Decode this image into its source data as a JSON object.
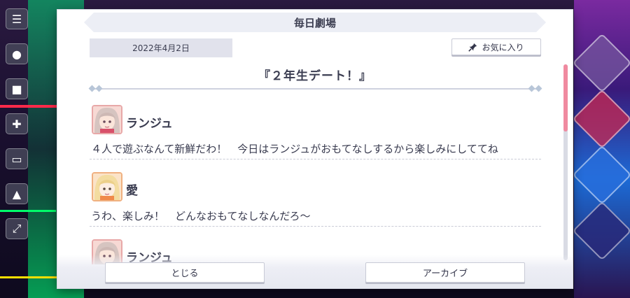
{
  "dialog": {
    "title": "毎日劇場",
    "date": "2022年4月2日",
    "favorite_label": "お気に入り",
    "story_title": "『２年生デート！』"
  },
  "messages": [
    {
      "speaker": "ランジュ",
      "text": "４人で遊ぶなんて新鮮だわ！　今日はランジュがおもてなしするから楽しみにしててね",
      "avatar": "lanzhu-avatar"
    },
    {
      "speaker": "愛",
      "text": "うわ、楽しみ！　どんなおもてなしなんだろ～",
      "avatar": "ai-avatar"
    },
    {
      "speaker": "ランジュ",
      "text": "",
      "avatar": "lanzhu-avatar"
    }
  ],
  "buttons": {
    "close": "とじる",
    "archive": "アーカイブ"
  },
  "colors": {
    "scroll_thumb": "#f08aa0",
    "banner": "#eceef5",
    "text": "#3a3c50"
  }
}
